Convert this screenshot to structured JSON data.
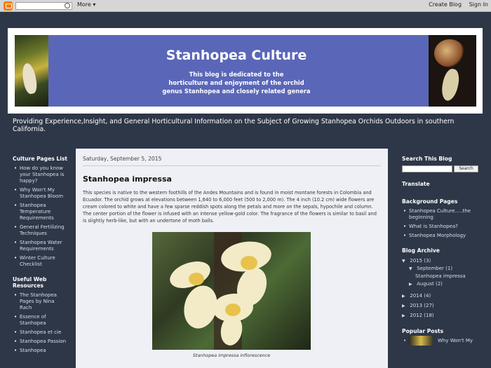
{
  "navbar": {
    "more": "More ▾",
    "create_blog": "Create Blog",
    "sign_in": "Sign In"
  },
  "header": {
    "title": "Stanhopea Culture",
    "subtitle_lines": [
      "This blog is dedicated to the",
      "horticulture and enjoyment of the orchid",
      "genus Stanhopea and closely related genera"
    ]
  },
  "description": "Providing Experience,Insight, and General Horticultural Information on the Subject of Growing Stanhopea Orchids Outdoors in southern California.",
  "left_sidebar": {
    "culture_title": "Culture Pages List",
    "culture_items": [
      "How do you know your Stanhopea is happy?",
      "Why Won't My Stanhopea Bloom",
      "Stanhopea Temperature Requirements",
      "General Fertilizing Techniques",
      "Stanhopea Water Requirements",
      "Winter Culture Checklist"
    ],
    "resources_title": "Useful Web Resources",
    "resources_items": [
      "The Stanhopea Pages by Nina Rach",
      "Essence of Stanhopea",
      "Stanhopea et cie",
      "Stanhopea Passion",
      "Stanhopea"
    ]
  },
  "post": {
    "date": "Saturday, September 5, 2015",
    "title": "Stanhopea impressa",
    "body": "This species is native to the western foothills of the Andes Mountains and is found in moist montane forests in Colombia and Ecuador.  The orchid grows at elevations between 1,640 to 6,000 feet (500 to 2,000 m).  The 4 inch (10.2 cm) wide flowers are cream colored to white and have a few sparse reddish spots along the petals and more on the sepals, hypochile and column.  The center portion of the flower is infused with an intense yellow-gold color. The fragrance of the flowers is similar to basil and is slightly herb-like, but with an undertone of moth balls.",
    "caption": "Stanhopea impressa inflorescence"
  },
  "right_sidebar": {
    "search_title": "Search This Blog",
    "search_button": "Search",
    "translate_title": "Translate",
    "background_title": "Background Pages",
    "background_items": [
      "Stanhopea Culture.....the beginning",
      "What is Stanhopea?",
      "Stanhopea Morphology"
    ],
    "archive_title": "Blog Archive",
    "archive": {
      "y2015": "2015",
      "y2015_count": "(3)",
      "september": "September",
      "september_count": "(1)",
      "post": "Stanhopea impressa",
      "august": "August",
      "august_count": "(2)",
      "y2014": "2014",
      "y2014_count": "(4)",
      "y2013": "2013",
      "y2013_count": "(27)",
      "y2012": "2012",
      "y2012_count": "(18)"
    },
    "popular_title": "Popular Posts",
    "popular_first": "Why Won't My"
  }
}
